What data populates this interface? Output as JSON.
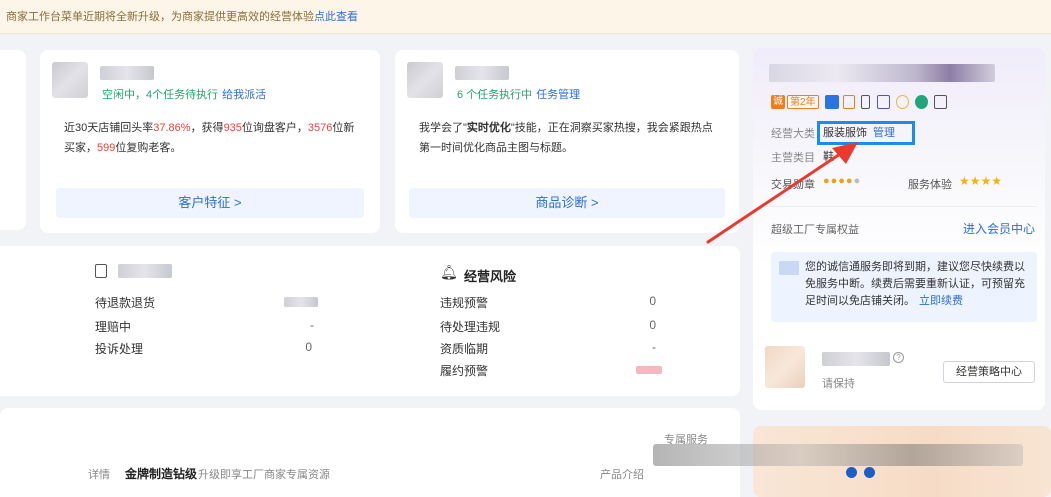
{
  "notice": {
    "text": "商家工作台菜单近期将全新升级，为商家提供更高效的经营体验",
    "link": "点此查看"
  },
  "customer_card": {
    "status": "空闲中，4个任务待执行",
    "link": "给我派活",
    "desc_1": "近30天店铺回头率",
    "rate": "37.86%",
    "desc_2": "，获得",
    "count_1": "935",
    "desc_3": "位询盘客户，",
    "count_2": "3576",
    "desc_4": "位新",
    "desc_5": "买家，",
    "count_3": "599",
    "desc_6": "位复购老客。",
    "button": "客户特征 >"
  },
  "product_card": {
    "status": "6 个任务执行中",
    "link": "任务管理",
    "desc_1": "我学会了\"",
    "highlight": "实时优化",
    "desc_2": "\"技能，正在洞察买家热搜，我会紧跟热点",
    "desc_3": "第一时间优化商品主图与标题。",
    "button": "商品诊断 >"
  },
  "aftersales": {
    "rows": [
      {
        "label": "待退款退货",
        "value": ""
      },
      {
        "label": "理赔中",
        "value": "-"
      },
      {
        "label": "投诉处理",
        "value": "0"
      }
    ]
  },
  "risk": {
    "title": "经营风险",
    "rows": [
      {
        "label": "违规预警",
        "value": "0"
      },
      {
        "label": "待处理违规",
        "value": "0"
      },
      {
        "label": "资质临期",
        "value": "-"
      },
      {
        "label": "履约预警",
        "value": ""
      }
    ]
  },
  "bottom_panel": {
    "detail_label": "详情",
    "gold_title": "金牌制造钻级",
    "gold_sub": "升级即享工厂商家专属资源",
    "product_intro": "产品介绍",
    "exclusive": "专属服务"
  },
  "profile": {
    "year_badge": "第2年",
    "scope_label": "经营大类",
    "scope_value": "服装服饰",
    "manage_link": "管理",
    "main_category_label": "主营类目",
    "main_category_value": "鞋",
    "trade_label": "交易勋章",
    "service_label": "服务体验",
    "service_stars": "★★★★",
    "rights_title": "超级工厂专属权益",
    "member_link": "进入会员中心",
    "expiry_text_1": "您的诚信通服务即将到期，建议您尽快续费以",
    "expiry_text_2": "免服务中断。续费后需要重新认证，可预留充",
    "expiry_text_3": "足时间以免店铺关闭。",
    "renew_link": "立即续费",
    "status_text": "请保持",
    "strategy_button": "经营策略中心"
  },
  "colors": {
    "accent": "#2c6fd6",
    "highlight_box": "#1a8cf0",
    "arrow": "#e83a2f",
    "green_status": "#24a36b",
    "red_number": "#e8453c"
  }
}
